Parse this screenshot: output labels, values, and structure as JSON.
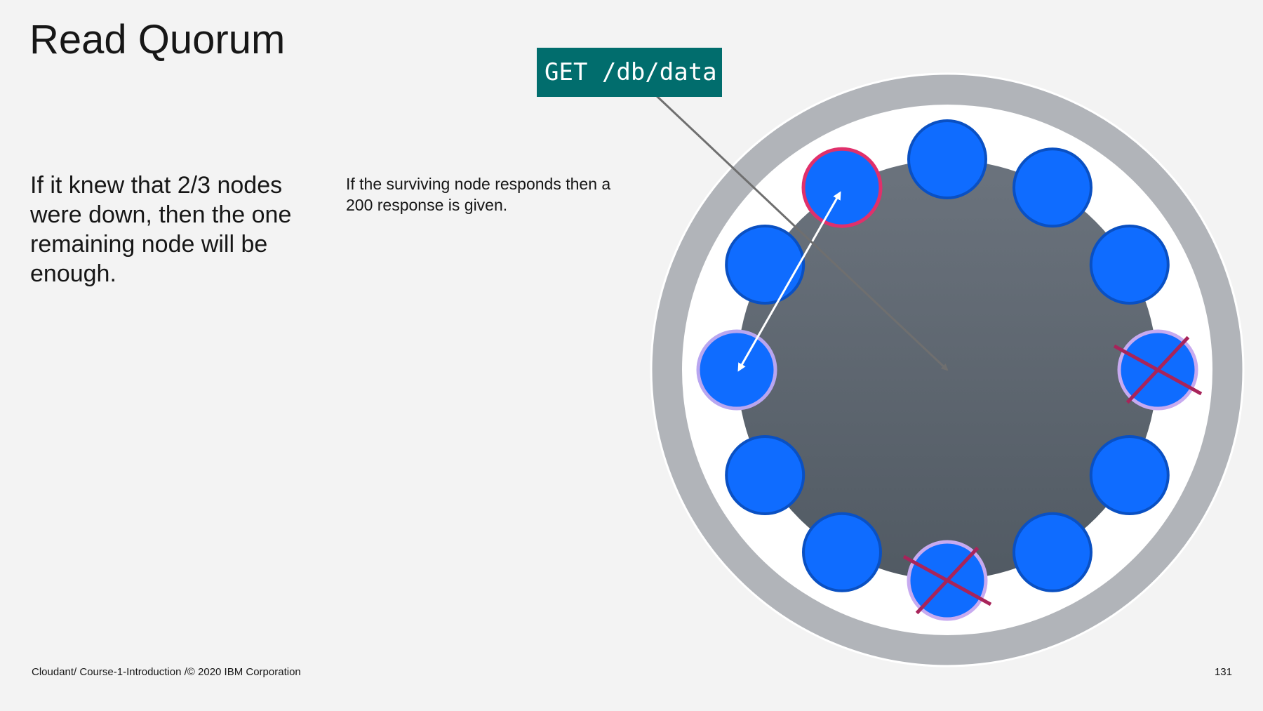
{
  "slide": {
    "title": "Read Quorum",
    "lead_text": "If it knew that 2/3 nodes were down, then the one remaining node will be enough.",
    "note_text": "If the surviving node responds then a 200 response is given.",
    "footer": "Cloudant/ Course-1-Introduction /© 2020 IBM Corporation",
    "page_number": "131"
  },
  "request": {
    "label": "GET /db/data"
  },
  "cluster": {
    "node_count": 12,
    "responding_node": "node-11",
    "coordinator_node": "node-9",
    "failed_nodes": [
      "node-3",
      "node-6"
    ]
  },
  "colors": {
    "background": "#f3f3f3",
    "outer_ring": "#b1b4b9",
    "ring_fill": "#ffffff",
    "core_top": "#6b737d",
    "core_bottom": "#515a63",
    "node_fill": "#0f6cff",
    "node_stroke": "#0a50c2",
    "responding_stroke": "#e0306b",
    "coordinator_stroke": "#b9a6f0",
    "failed_stroke": "#c7aaf0",
    "cross": "#a8245a",
    "request_box": "#016d6d",
    "request_arrow": "#6f6f6f",
    "response_arrow": "#ffffff"
  }
}
